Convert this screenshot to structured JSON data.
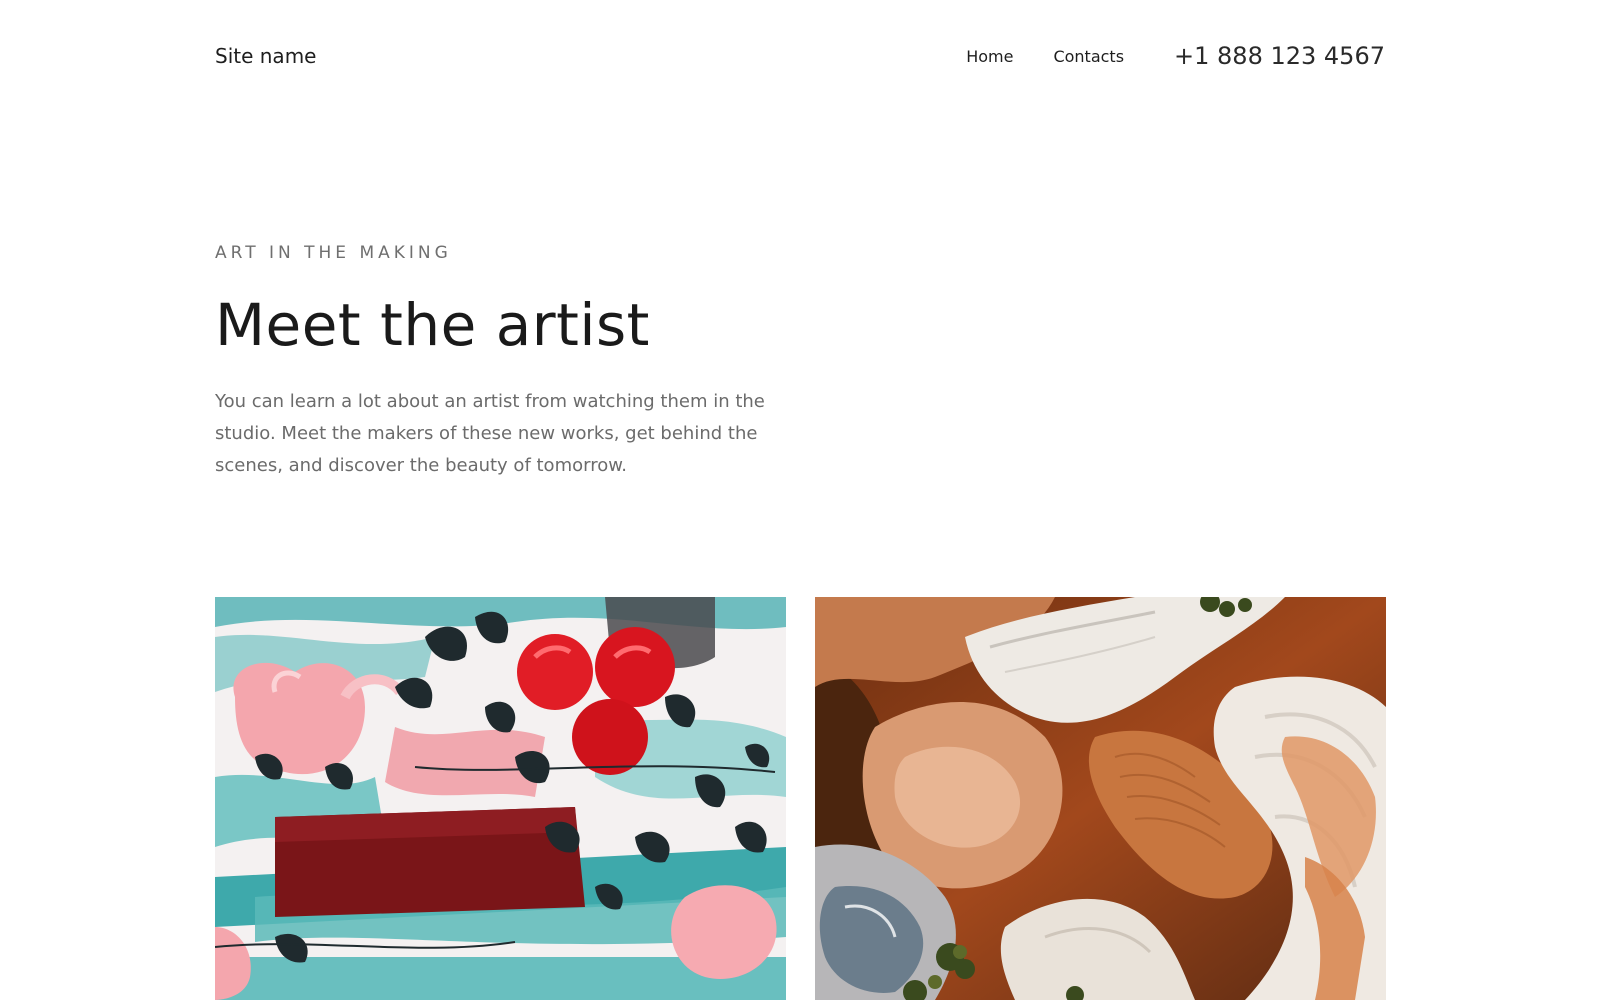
{
  "header": {
    "site_name": "Site name",
    "nav": [
      {
        "label": "Home"
      },
      {
        "label": "Contacts"
      }
    ],
    "phone": "+1 888 123 4567"
  },
  "hero": {
    "eyebrow": "ART IN THE MAKING",
    "title": "Meet the artist",
    "text": "You can learn a lot about an artist from watching them in the studio. Meet the makers of these new works, get behind the scenes, and discover the beauty of tomorrow."
  },
  "gallery": {
    "items": [
      {
        "subject": "abstract painting with pomegranates and leaves"
      },
      {
        "subject": "aerial view of orange and white earth textures"
      }
    ]
  },
  "colors": {
    "text_primary": "#1a1a1a",
    "text_muted": "#6b6b6b",
    "background": "#ffffff"
  }
}
